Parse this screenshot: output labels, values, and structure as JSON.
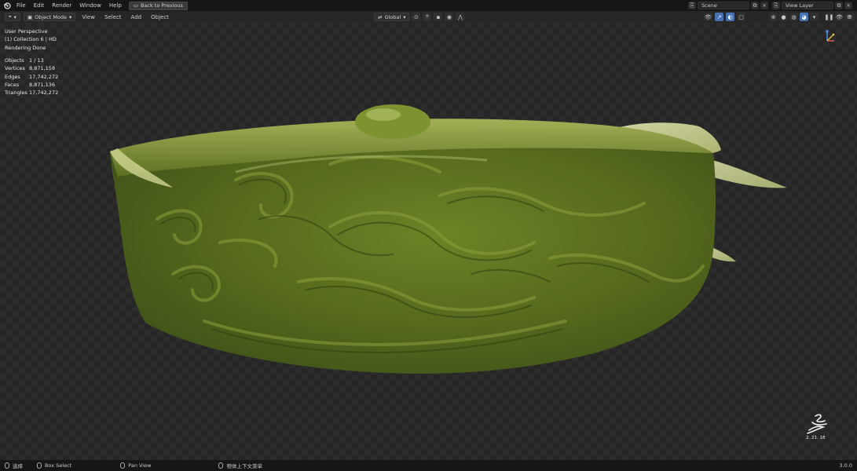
{
  "topbar": {
    "menu": [
      "File",
      "Edit",
      "Render",
      "Window",
      "Help"
    ],
    "back_label": "Back to Previous",
    "scene": "Scene",
    "view_layer": "View Layer"
  },
  "header": {
    "mode": "Object Mode",
    "menus": [
      "View",
      "Select",
      "Add",
      "Object"
    ],
    "orientation": "Global"
  },
  "viewport": {
    "view_name": "User Perspective",
    "collection": "(1) Collection 6 | HD",
    "render_status": "Rendering Done",
    "stats": [
      {
        "label": "Objects",
        "value": "1 / 13"
      },
      {
        "label": "Vertices",
        "value": "8,871,158"
      },
      {
        "label": "Edges",
        "value": "17,742,272"
      },
      {
        "label": "Faces",
        "value": "8,871,136"
      },
      {
        "label": "Triangles",
        "value": "17,742,272"
      }
    ],
    "signature_date": "2. 21. 18"
  },
  "statusbar": {
    "select": "选择",
    "box_select": "Box Select",
    "pan_view": "Pan View",
    "context_menu": "物体上下文菜单",
    "version": "3.0.0"
  },
  "colors": {
    "accent": "#4772b3",
    "jade_dark": "#3e5218",
    "jade_mid": "#6c8326",
    "jade_light": "#c7cf7e"
  }
}
